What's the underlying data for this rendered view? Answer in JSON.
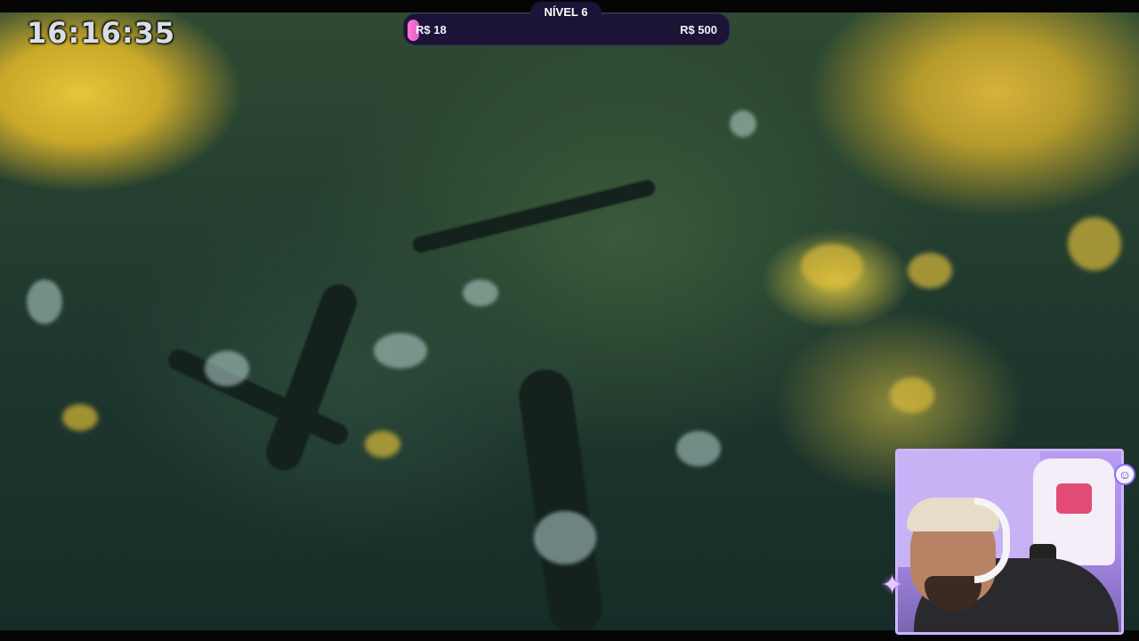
{
  "stream": {
    "clock": "16:16:35",
    "goal": {
      "level_label": "NÍVEL 6",
      "current": "R$ 18",
      "target": "R$ 500",
      "progress_fraction": 0.036,
      "fill_color": "#ff7ad1",
      "bar_color": "#1b1436"
    },
    "webcam": {
      "frame_color": "#cdb6ff",
      "sparkle_icon": "✦",
      "badge_icon": "☺"
    }
  }
}
